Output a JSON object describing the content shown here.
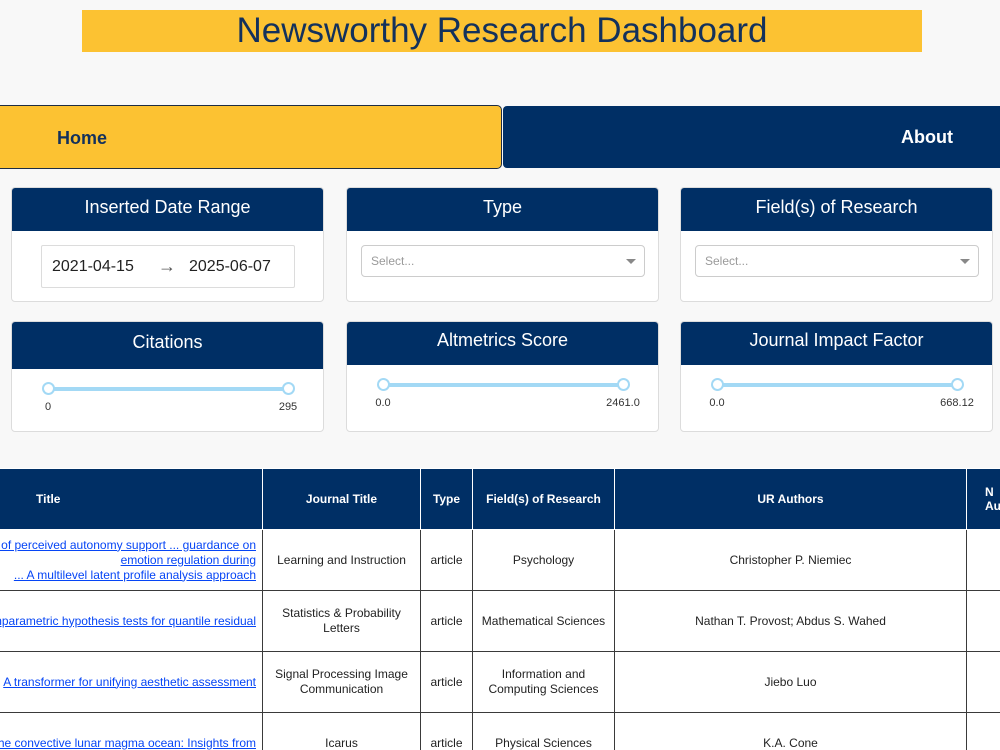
{
  "header": {
    "title": "Newsworthy Research Dashboard"
  },
  "nav": {
    "home": "Home",
    "about": "About"
  },
  "filters": {
    "date_range": {
      "title": "Inserted Date Range",
      "start": "2021-04-15",
      "arrow": "→",
      "end": "2025-06-07"
    },
    "type": {
      "title": "Type",
      "placeholder": "Select..."
    },
    "fields": {
      "title": "Field(s) of Research",
      "placeholder": "Select..."
    },
    "citations": {
      "title": "Citations",
      "min_label": "0",
      "max_label": "295",
      "min": 0,
      "max": 295,
      "low": 0,
      "high": 295
    },
    "altmetrics": {
      "title": "Altmetrics Score",
      "min_label": "0.0",
      "max_label": "2461.0",
      "min": 0.0,
      "max": 2461.0,
      "low": 0.0,
      "high": 2461.0
    },
    "impact": {
      "title": "Journal Impact Factor",
      "min_label": "0.0",
      "max_label": "668.12",
      "min": 0.0,
      "max": 668.12,
      "low": 0.0,
      "high": 668.12
    }
  },
  "table": {
    "headers": [
      "Title",
      "Journal Title",
      "Type",
      "Field(s) of Research",
      "UR Authors",
      "N Au"
    ],
    "rows": [
      {
        "title_l1": "The effects of perceived autonomy support ... guardance on emotion regulation during",
        "title_l2": "... A multilevel latent profile analysis approach",
        "journal": "Learning and Instruction",
        "type": "article",
        "field": "Psychology",
        "authors": "Christopher P. Niemiec",
        "n": ""
      },
      {
        "title_l1": "Nonparametric hypothesis tests for quantile residual",
        "title_l2": "",
        "journal": "Statistics & Probability Letters",
        "type": "article",
        "field": "Mathematical Sciences",
        "authors": "Nathan T. Provost; Abdus S. Wahed",
        "n": ""
      },
      {
        "title_l1": "A transformer for unifying aesthetic assessment",
        "title_l2": "",
        "journal": "Signal Processing Image Communication",
        "type": "article",
        "field": "Information and Computing Sciences",
        "authors": "Jiebo Luo",
        "n": ""
      },
      {
        "title_l1": "The convective lunar magma ocean: Insights from",
        "title_l2": "",
        "journal": "Icarus",
        "type": "article",
        "field": "Physical Sciences",
        "authors": "K.A. Cone",
        "n": ""
      }
    ]
  },
  "colors": {
    "navy": "#002f65",
    "gold": "#fcc232",
    "slider": "#a3d9f5",
    "link": "#0645f5"
  }
}
